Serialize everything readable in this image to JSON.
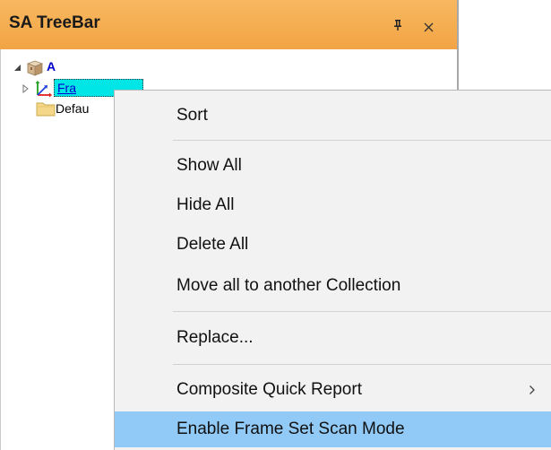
{
  "panel": {
    "title": "SA TreeBar",
    "pin_icon": "pin-icon",
    "close_icon": "close-icon",
    "colors": {
      "title_bg": "#f2a444",
      "tree_blue": "#0000cc",
      "selection": "#00e6e6"
    }
  },
  "tree": {
    "root": {
      "label": "A",
      "expanded": true,
      "icon": "collection-box-icon"
    },
    "frame_node": {
      "label": "Fra",
      "expanded": false,
      "icon": "frame-axes-icon",
      "selected": true
    },
    "default_node": {
      "label": "Defau",
      "icon": "folder-icon"
    }
  },
  "context_menu": {
    "items": [
      {
        "label": "Sort"
      },
      {
        "label": "Show All"
      },
      {
        "label": "Hide All"
      },
      {
        "label": "Delete All"
      },
      {
        "label": "Move all to another Collection"
      },
      {
        "label": "Replace..."
      },
      {
        "label": "Composite Quick Report",
        "has_submenu": true
      },
      {
        "label": "Enable Frame Set Scan Mode",
        "highlighted": true
      }
    ],
    "highlight_color": "#91c9f7"
  }
}
